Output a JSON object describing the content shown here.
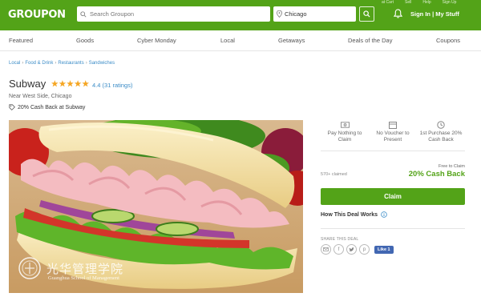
{
  "header": {
    "logo": "GROUPON",
    "search_placeholder": "Search Groupon",
    "location_value": "Chicago",
    "top_links": [
      "at Cart",
      "Sell",
      "Help",
      "Sign Up"
    ],
    "signin_label": "Sign In | My Stuff"
  },
  "nav": {
    "items": [
      "Featured",
      "Goods",
      "Cyber Monday",
      "Local",
      "Getaways",
      "Deals of the Day",
      "Coupons"
    ]
  },
  "breadcrumb": [
    "Local",
    "Food & Drink",
    "Restaurants",
    "Sandwiches"
  ],
  "deal": {
    "title": "Subway",
    "rating": "4.4",
    "ratings_count": "(31 ratings)",
    "area": "Near West Side, Chicago",
    "cashback": "20% Cash Back at Subway"
  },
  "watermark": {
    "cn": "光华管理学院",
    "en": "Guanghua School of Management"
  },
  "features": [
    {
      "icon": "pay-icon",
      "label": "Pay Nothing to Claim"
    },
    {
      "icon": "voucher-icon",
      "label": "No Voucher to Present"
    },
    {
      "icon": "clock-icon",
      "label": "1st Purchase 20% Cash Back"
    }
  ],
  "offer": {
    "claimed": "570+ claimed",
    "free_label": "Free to Claim",
    "cashback_big": "20% Cash Back",
    "claim_button": "Claim",
    "how_label": "How This Deal Works"
  },
  "share": {
    "label": "SHARE THIS DEAL",
    "icons": [
      "email-icon",
      "facebook-icon",
      "twitter-icon",
      "pinterest-icon"
    ],
    "like_label": "Like 1"
  },
  "colors": {
    "brand_green": "#53a318",
    "link_blue": "#3b8cc7",
    "star_gold": "#f5a623"
  }
}
